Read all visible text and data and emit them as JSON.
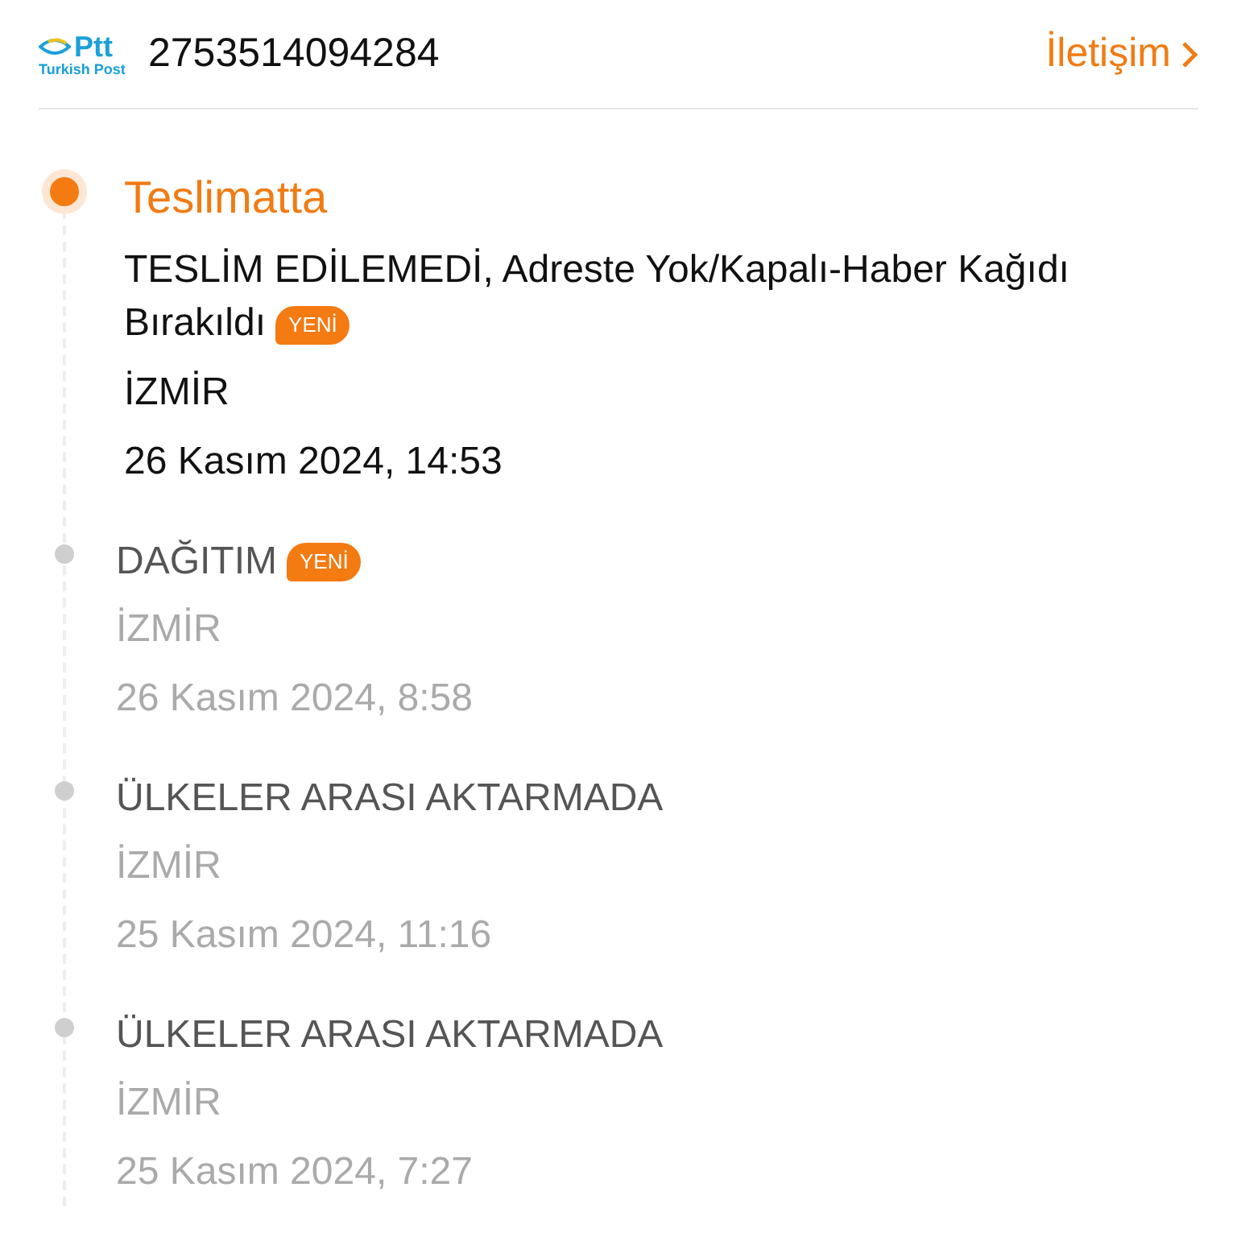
{
  "header": {
    "logo": {
      "brand": "Ptt",
      "subtitle": "Turkish Post"
    },
    "tracking_number": "2753514094284",
    "contact_link": "İletişim"
  },
  "events": [
    {
      "current": true,
      "status": "Teslimatta",
      "detail": "TESLİM EDİLEMEDİ, Adreste Yok/Kapalı-Haber Kağıdı Bırakıldı",
      "badge": "YENİ",
      "location": "İZMİR",
      "time": "26 Kasım 2024, 14:53"
    },
    {
      "current": false,
      "status": "DAĞITIM",
      "badge": "YENİ",
      "location": "İZMİR",
      "time": "26 Kasım 2024, 8:58"
    },
    {
      "current": false,
      "status": "ÜLKELER ARASI AKTARMADA",
      "location": "İZMİR",
      "time": "25 Kasım 2024, 11:16"
    },
    {
      "current": false,
      "status": "ÜLKELER ARASI AKTARMADA",
      "location": "İZMİR",
      "time": "25 Kasım 2024, 7:27"
    }
  ]
}
